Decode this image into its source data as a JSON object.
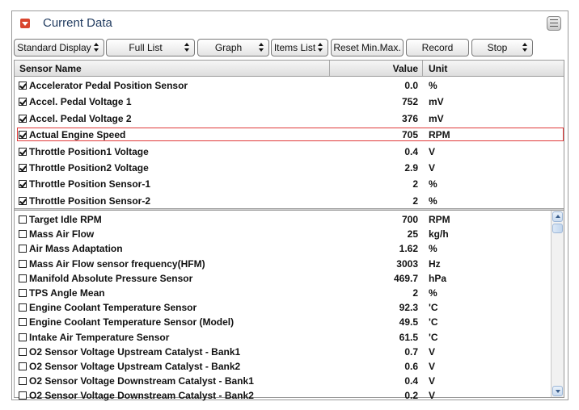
{
  "panel": {
    "title": "Current Data"
  },
  "toolbar": [
    {
      "label": "Standard Display",
      "dropdown": true
    },
    {
      "label": "Full List",
      "dropdown": true
    },
    {
      "label": "Graph",
      "dropdown": true
    },
    {
      "label": "Items List",
      "dropdown": true
    },
    {
      "label": "Reset Min.Max.",
      "dropdown": false
    },
    {
      "label": "Record",
      "dropdown": false
    },
    {
      "label": "Stop",
      "dropdown": true
    }
  ],
  "table": {
    "columns": {
      "name": "Sensor Name",
      "value": "Value",
      "unit": "Unit"
    },
    "selected_rows": [
      {
        "name": "Accelerator Pedal Position Sensor",
        "value": "0.0",
        "unit": "%",
        "checked": true
      },
      {
        "name": "Accel. Pedal Voltage 1",
        "value": "752",
        "unit": "mV",
        "checked": true
      },
      {
        "name": "Accel. Pedal Voltage 2",
        "value": "376",
        "unit": "mV",
        "checked": true
      },
      {
        "name": "Actual Engine Speed",
        "value": "705",
        "unit": "RPM",
        "checked": true,
        "highlighted": true
      },
      {
        "name": "Throttle Position1 Voltage",
        "value": "0.4",
        "unit": "V",
        "checked": true
      },
      {
        "name": "Throttle Position2 Voltage",
        "value": "2.9",
        "unit": "V",
        "checked": true
      },
      {
        "name": "Throttle Position Sensor-1",
        "value": "2",
        "unit": "%",
        "checked": true
      },
      {
        "name": "Throttle Position Sensor-2",
        "value": "2",
        "unit": "%",
        "checked": true
      }
    ],
    "other_rows": [
      {
        "name": "Target Idle RPM",
        "value": "700",
        "unit": "RPM",
        "checked": false
      },
      {
        "name": "Mass Air Flow",
        "value": "25",
        "unit": "kg/h",
        "checked": false
      },
      {
        "name": "Air Mass Adaptation",
        "value": "1.62",
        "unit": "%",
        "checked": false
      },
      {
        "name": "Mass Air Flow sensor frequency(HFM)",
        "value": "3003",
        "unit": "Hz",
        "checked": false
      },
      {
        "name": "Manifold Absolute Pressure Sensor",
        "value": "469.7",
        "unit": "hPa",
        "checked": false
      },
      {
        "name": "TPS Angle Mean",
        "value": "2",
        "unit": "%",
        "checked": false
      },
      {
        "name": "Engine Coolant Temperature Sensor",
        "value": "92.3",
        "unit": "'C",
        "checked": false
      },
      {
        "name": "Engine Coolant Temperature Sensor (Model)",
        "value": "49.5",
        "unit": "'C",
        "checked": false
      },
      {
        "name": "Intake Air Temperature Sensor",
        "value": "61.5",
        "unit": "'C",
        "checked": false
      },
      {
        "name": "O2 Sensor Voltage Upstream Catalyst - Bank1",
        "value": "0.7",
        "unit": "V",
        "checked": false
      },
      {
        "name": "O2 Sensor Voltage Upstream Catalyst - Bank2",
        "value": "0.6",
        "unit": "V",
        "checked": false
      },
      {
        "name": "O2 Sensor Voltage Downstream Catalyst - Bank1",
        "value": "0.4",
        "unit": "V",
        "checked": false
      },
      {
        "name": "O2 Sensor Voltage Downstream Catalyst - Bank2",
        "value": "0.2",
        "unit": "V",
        "checked": false
      }
    ]
  }
}
